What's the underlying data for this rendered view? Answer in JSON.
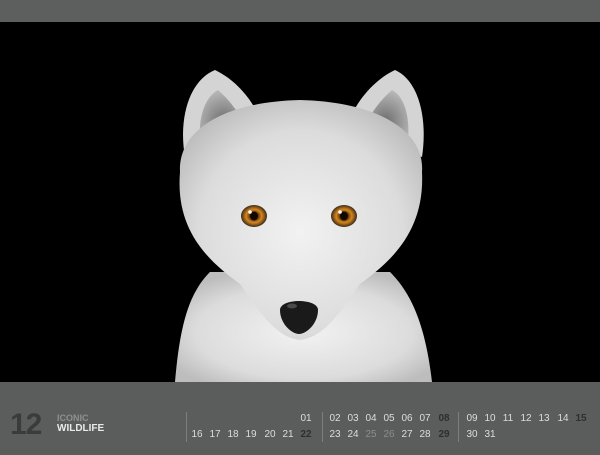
{
  "calendar": {
    "month_number": "12",
    "brand_line1": "ICONIC",
    "brand_line2": "WILDLIFE",
    "credit": "",
    "row1_left": [],
    "row1": [
      "01",
      "02",
      "03",
      "04",
      "05",
      "06",
      "07",
      "08",
      "09",
      "10",
      "11",
      "12",
      "13",
      "14",
      "15"
    ],
    "row2": [
      "16",
      "17",
      "18",
      "19",
      "20",
      "21",
      "22",
      "23",
      "24",
      "25",
      "26",
      "27",
      "28",
      "29",
      "30",
      "31"
    ],
    "highlight": [
      "08",
      "15",
      "22",
      "29"
    ],
    "dim": [
      "25",
      "26"
    ]
  },
  "photo": {
    "subject": "white arctic fox portrait on black background"
  }
}
